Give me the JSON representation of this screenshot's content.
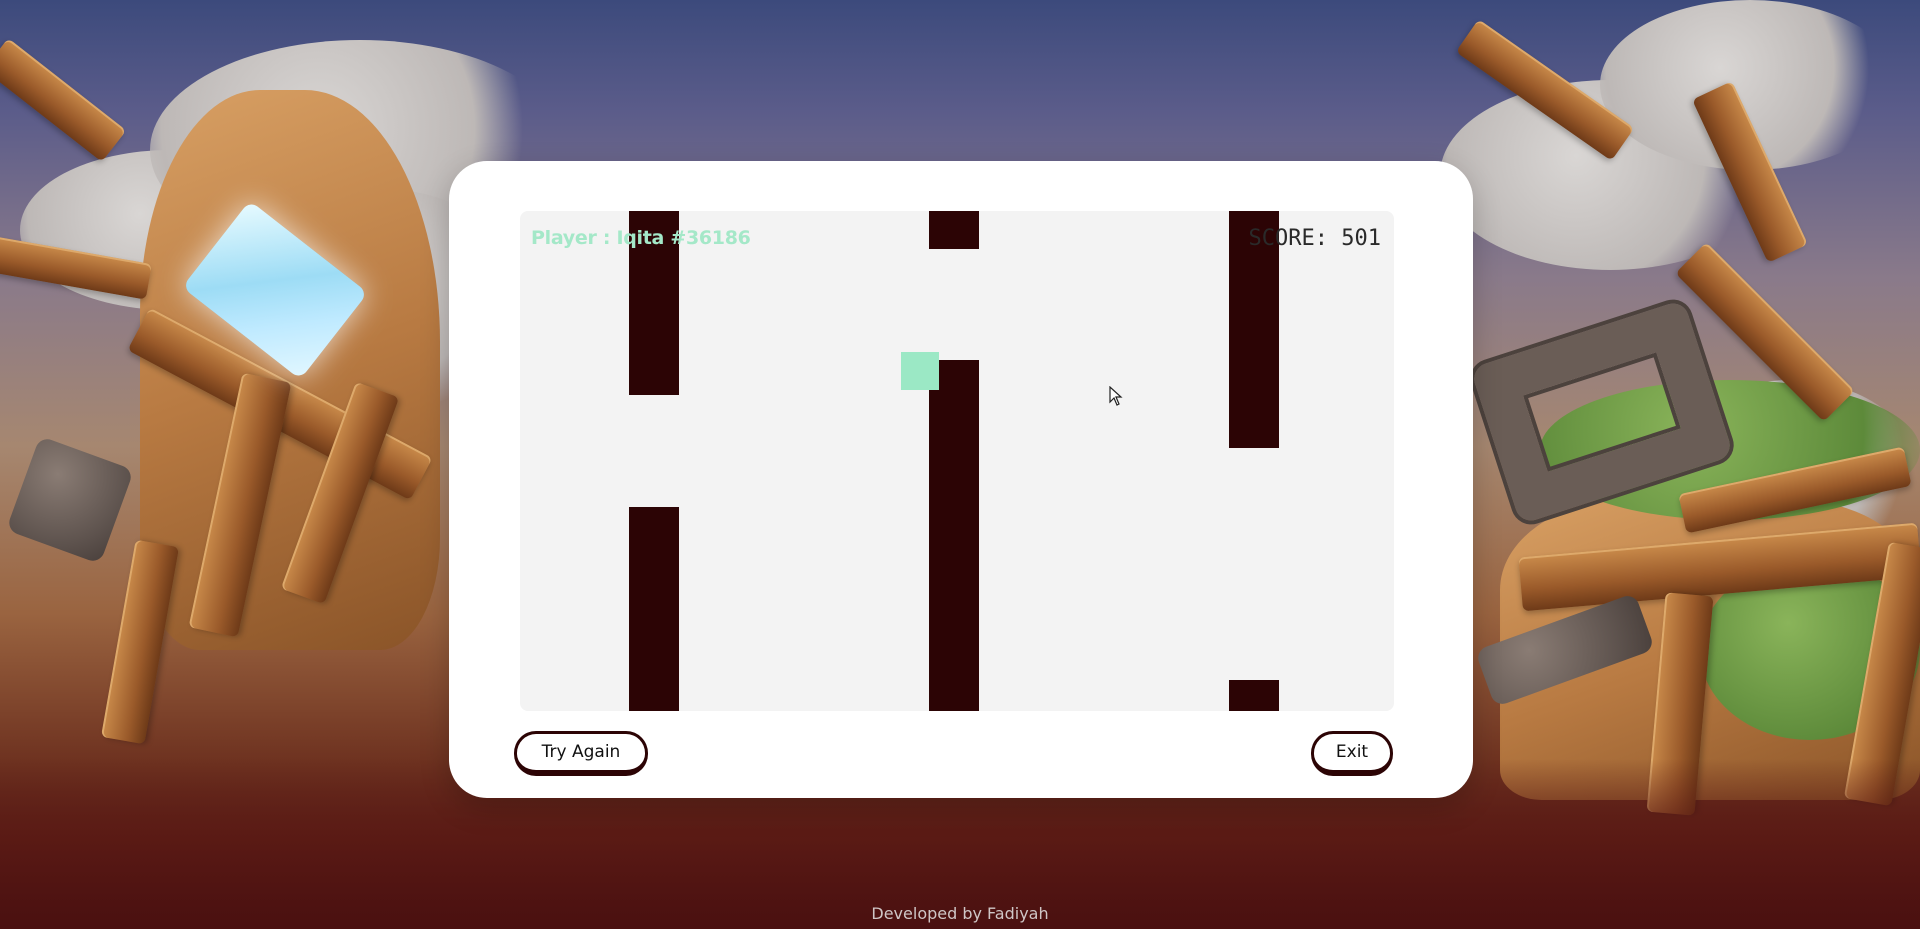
{
  "game": {
    "player_label": "Player : Iqita #36186",
    "score_label": "SCORE:",
    "score_value": "501",
    "try_again_label": "Try Again",
    "exit_label": "Exit"
  },
  "footer": {
    "credit": "Developed by Fadiyah"
  },
  "colors": {
    "pipe": "#2c0405",
    "bird": "#9be8c5",
    "player_label": "#a4e8c8",
    "canvas_bg": "#f3f3f3"
  }
}
